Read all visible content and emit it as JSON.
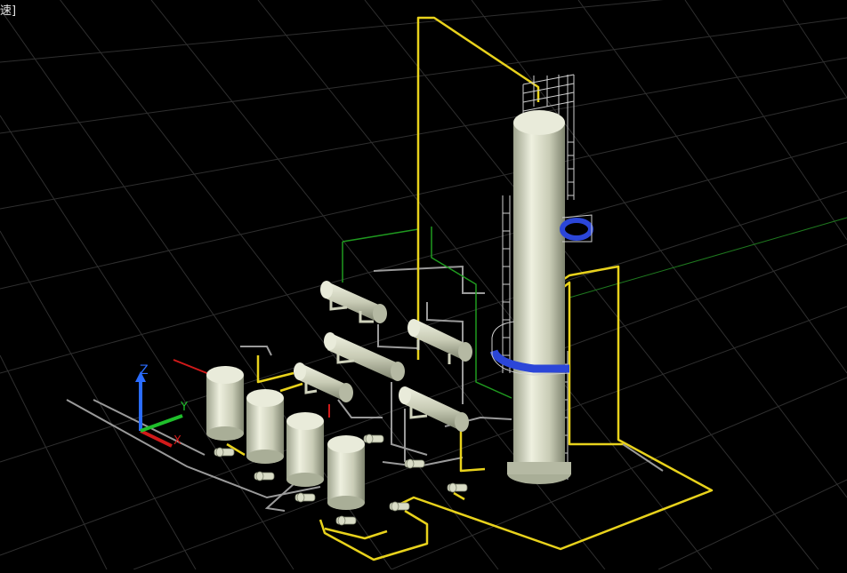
{
  "viewport": {
    "label": "[视觉样式:真实 - 快速]",
    "label_visible": "速]"
  },
  "ucs": {
    "x_label": "X",
    "y_label": "Y",
    "z_label": "Z"
  },
  "colors": {
    "background": "#000000",
    "grid": "#2f2f2f",
    "pipe_yellow": "#e8d21c",
    "pipe_gray": "#9a9a9a",
    "pipe_green": "#1f9a1f",
    "equipment": "#d9dcc6",
    "equipment_shade": "#8d927c",
    "platform_blue": "#2b46d8",
    "axis_x": "#d01a1a",
    "axis_y": "#1fbf2b",
    "axis_z": "#2a6cff"
  },
  "equipment": [
    {
      "type": "column",
      "name": "distillation-column"
    },
    {
      "type": "vessel",
      "name": "vertical-drum-1"
    },
    {
      "type": "vessel",
      "name": "vertical-drum-2"
    },
    {
      "type": "vessel",
      "name": "vertical-drum-3"
    },
    {
      "type": "vessel",
      "name": "vertical-drum-4"
    },
    {
      "type": "exchanger",
      "name": "exchanger-1"
    },
    {
      "type": "exchanger",
      "name": "exchanger-2"
    },
    {
      "type": "exchanger",
      "name": "exchanger-3"
    },
    {
      "type": "exchanger",
      "name": "exchanger-4"
    },
    {
      "type": "exchanger",
      "name": "exchanger-5"
    },
    {
      "type": "pump",
      "name": "pump-1"
    },
    {
      "type": "pump",
      "name": "pump-2"
    },
    {
      "type": "pump",
      "name": "pump-3"
    },
    {
      "type": "pump",
      "name": "pump-4"
    },
    {
      "type": "pump",
      "name": "pump-5"
    },
    {
      "type": "pump",
      "name": "pump-6"
    },
    {
      "type": "pump",
      "name": "pump-7"
    }
  ]
}
